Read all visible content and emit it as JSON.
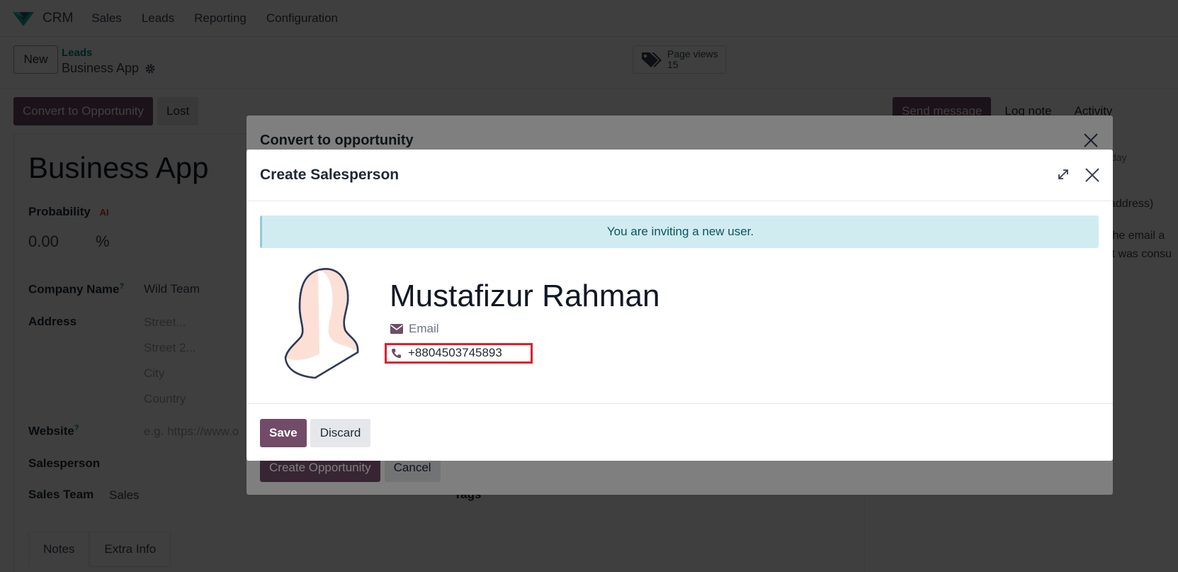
{
  "navbar": {
    "app_name": "CRM",
    "menu": [
      "Sales",
      "Leads",
      "Reporting",
      "Configuration"
    ]
  },
  "control_panel": {
    "new_label": "New",
    "breadcrumb_parent": "Leads",
    "breadcrumb_current": "Business App",
    "page_views_label": "Page views",
    "page_views_count": "15"
  },
  "statusbar": {
    "convert_label": "Convert to Opportunity",
    "lost_label": "Lost"
  },
  "form": {
    "title": "Business App",
    "probability_label": "Probability",
    "ai_badge": "AI",
    "probability_value": "0.00",
    "percent": "%",
    "company_label": "Company Name",
    "company_value": "Wild Team",
    "address_label": "Address",
    "street_ph": "Street...",
    "street2_ph": "Street 2...",
    "city_ph": "City",
    "country_ph": "Country",
    "website_label": "Website",
    "website_ph": "e.g. https://www.o",
    "salesperson_label": "Salesperson",
    "salesteam_label": "Sales Team",
    "salesteam_value": "Sales",
    "tags_label": "Tags",
    "tabs": [
      "Notes",
      "Extra Info"
    ],
    "help_mark": "?"
  },
  "chatter": {
    "send_message": "Send message",
    "log_note": "Log note",
    "activity": "Activity",
    "day_text": "day",
    "line1": "address)",
    "line2": "the email a",
    "line3": "it was consu"
  },
  "convert_dialog": {
    "title": "Convert to opportunity",
    "create_label": "Create Opportunity",
    "cancel_label": "Cancel"
  },
  "salesperson_dialog": {
    "title": "Create Salesperson",
    "alert": "You are inviting a new user.",
    "name": "Mustafizur Rahman",
    "email_placeholder": "Email",
    "phone": "+8804503745893",
    "save_label": "Save",
    "discard_label": "Discard"
  },
  "colors": {
    "primary": "#714b67",
    "link": "#017e84",
    "alert_bg": "#d1ecf1",
    "highlight": "#e11d2a"
  }
}
